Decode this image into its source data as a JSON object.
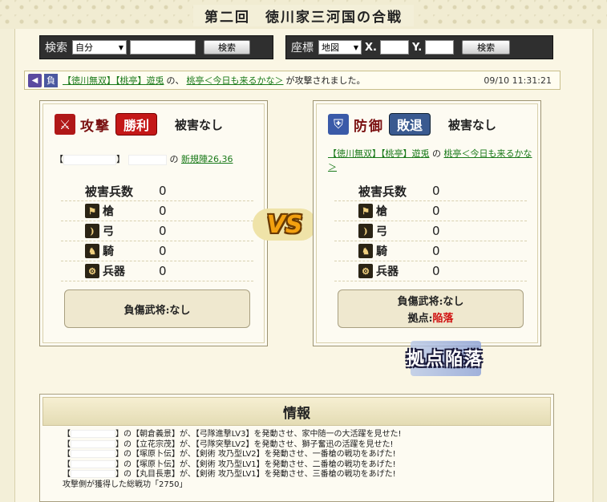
{
  "page": {
    "title": "第二回　徳川家三河国の合戦"
  },
  "search_player": {
    "label": "検索",
    "select_value": "自分",
    "button": "検索"
  },
  "search_coords": {
    "label": "座標",
    "select_value": "地図",
    "x_label": "X.",
    "y_label": "Y.",
    "button": "検索"
  },
  "notice": {
    "result_badge": "負",
    "attacker": "【徳川無双】【桃亭】遊兎",
    "connector": "の、",
    "target": "桃亭＜今日も来るかな＞",
    "message": "が攻撃されました。",
    "time": "09/10 11:31:21"
  },
  "attacker": {
    "role": "攻撃",
    "result": "勝利",
    "damage": "被害なし",
    "bracket_open": "【",
    "bracket_close": "】",
    "connector": "の",
    "location": "新規陣26,36",
    "losses_header": "被害兵数",
    "losses_total": "0",
    "units": [
      {
        "name": "槍",
        "icon": "spear-icon",
        "value": "0"
      },
      {
        "name": "弓",
        "icon": "bow-icon",
        "value": "0"
      },
      {
        "name": "騎",
        "icon": "horse-icon",
        "value": "0"
      },
      {
        "name": "兵器",
        "icon": "siege-icon",
        "value": "0"
      }
    ],
    "wounded": "負傷武将:なし"
  },
  "defender": {
    "role": "防御",
    "result": "敗退",
    "damage": "被害なし",
    "owner": "【徳川無双】【桃亭】遊兎",
    "connector": "の",
    "location": "桃亭＜今日も来るかな＞",
    "losses_header": "被害兵数",
    "losses_total": "0",
    "units": [
      {
        "name": "槍",
        "icon": "spear-icon",
        "value": "0"
      },
      {
        "name": "弓",
        "icon": "bow-icon",
        "value": "0"
      },
      {
        "name": "騎",
        "icon": "horse-icon",
        "value": "0"
      },
      {
        "name": "兵器",
        "icon": "siege-icon",
        "value": "0"
      }
    ],
    "wounded": "負傷武将:なし",
    "base_label": "拠点:",
    "base_status": "陥落"
  },
  "vs_text": "VS",
  "fallen_stamp": "拠点陥落",
  "info": {
    "title": "情報",
    "lines": [
      {
        "pre": "【",
        "text": "】の【朝倉義景】が、【弓隊進撃LV3】を発動させ、家中随一の大活躍を見せた!"
      },
      {
        "pre": "【",
        "text": "】の【立花宗茂】が、【弓隊突撃LV2】を発動させ、獅子奮迅の活躍を見せた!"
      },
      {
        "pre": "【",
        "text": "】の【塚原卜伝】が、【剣術 攻乃型LV2】を発動させ、一番槍の戦功をあげた!"
      },
      {
        "pre": "【",
        "text": "】の【塚原卜伝】が、【剣術 攻乃型LV1】を発動させ、二番槍の戦功をあげた!"
      },
      {
        "pre": "【",
        "text": "】の【丸目長恵】が、【剣術 攻乃型LV1】を発動させ、三番槍の戦功をあげた!"
      }
    ],
    "total": "攻撃側が獲得した総戦功「2750」"
  },
  "colors": {
    "attack_icon": "#b01818",
    "victory_badge": "#c41818",
    "defense_icon": "#3a5aa8",
    "defeat_badge": "#3a5a90",
    "link": "#1a7a1a",
    "fallen": "#d01010"
  }
}
